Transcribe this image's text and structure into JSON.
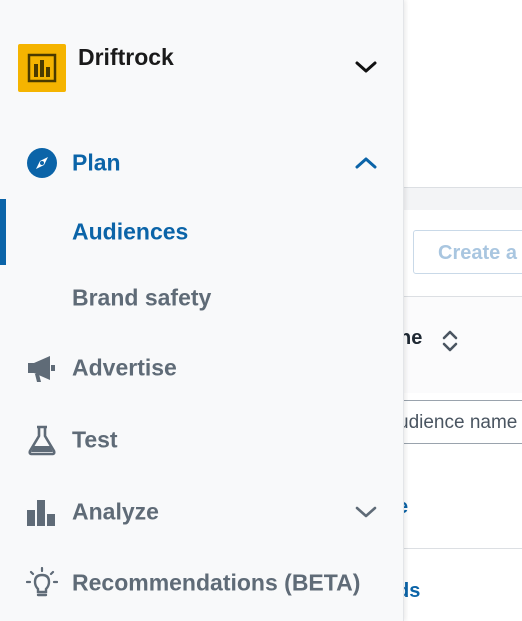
{
  "brand": {
    "name": "Driftrock"
  },
  "nav": {
    "plan": {
      "label": "Plan",
      "expanded": true
    },
    "plan_children": [
      {
        "label": "Audiences",
        "active": true
      },
      {
        "label": "Brand safety",
        "active": false
      }
    ],
    "advertise": {
      "label": "Advertise"
    },
    "test": {
      "label": "Test"
    },
    "analyze": {
      "label": "Analyze"
    },
    "recommendations": {
      "label": "Recommendations (BETA)"
    }
  },
  "background": {
    "create_button_label": "Create a",
    "column_header_label": "ne",
    "filter_value": "udience name",
    "row_links": [
      "e",
      "ds"
    ]
  },
  "colors": {
    "accent": "#0b64a8",
    "logo_bg": "#f5b400",
    "nav_text": "#5f6b77"
  }
}
